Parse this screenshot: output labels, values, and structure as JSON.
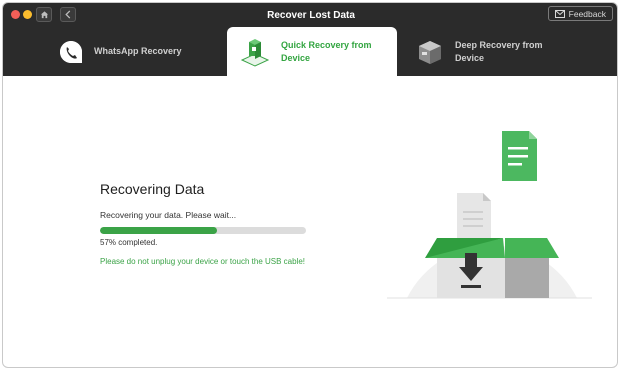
{
  "window": {
    "title": "Recover Lost Data"
  },
  "toolbar": {
    "feedback_label": "Feedback"
  },
  "tabs": [
    {
      "label_line1": "WhatsApp Recovery",
      "label_line2": "",
      "selected": false
    },
    {
      "label_line1": "Quick Recovery from",
      "label_line2": "Device",
      "selected": true
    },
    {
      "label_line1": "Deep Recovery from",
      "label_line2": "Device",
      "selected": false
    }
  ],
  "main": {
    "title": "Recovering Data",
    "subtitle": "Recovering your data. Please wait...",
    "progress": {
      "percent": 57,
      "text": "57% completed."
    },
    "warning": "Please do not unplug your device or touch the USB cable!"
  },
  "colors": {
    "accent": "#3ba347",
    "header_bg": "#2b2b2b"
  },
  "icons": [
    "home-icon",
    "back-icon",
    "mail-icon",
    "whatsapp-phone-icon",
    "quick-recovery-icon",
    "deep-recovery-icon",
    "recovery-box-illustration"
  ]
}
